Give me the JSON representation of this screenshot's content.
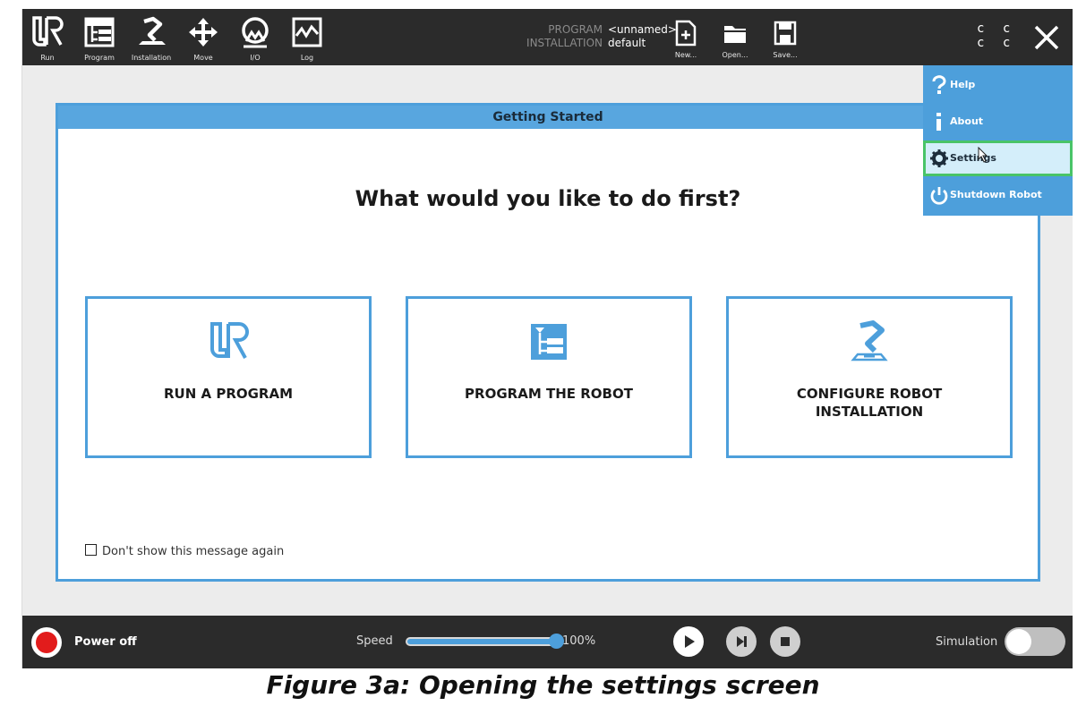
{
  "toolbar": {
    "tabs": [
      {
        "label": "Run",
        "icon": "ur-logo-icon"
      },
      {
        "label": "Program",
        "icon": "program-tree-icon"
      },
      {
        "label": "Installation",
        "icon": "robot-arm-icon"
      },
      {
        "label": "Move",
        "icon": "move-arrows-icon"
      },
      {
        "label": "I/O",
        "icon": "io-icon"
      },
      {
        "label": "Log",
        "icon": "log-chart-icon"
      }
    ],
    "program_key": "PROGRAM",
    "program_value": "<unnamed>",
    "installation_key": "INSTALLATION",
    "installation_value": "default",
    "new_label": "New...",
    "open_label": "Open...",
    "save_label": "Save...",
    "cc_top": "c c",
    "cc_bottom": "c c"
  },
  "dialog": {
    "title": "Getting Started",
    "question": "What would you like to do first?",
    "cards": [
      {
        "line1": "RUN A PROGRAM",
        "line2": ""
      },
      {
        "line1": "PROGRAM THE ROBOT",
        "line2": ""
      },
      {
        "line1": "CONFIGURE ROBOT",
        "line2": "INSTALLATION"
      }
    ],
    "checkbox_label": "Don't show this message again",
    "checkbox_checked": false
  },
  "menu": {
    "items": [
      {
        "label": "Help",
        "icon": "help-icon"
      },
      {
        "label": "About",
        "icon": "info-icon"
      },
      {
        "label": "Settings",
        "icon": "gear-icon",
        "selected": true
      },
      {
        "label": "Shutdown Robot",
        "icon": "power-icon"
      }
    ]
  },
  "bottom": {
    "power_label": "Power off",
    "speed_label": "Speed",
    "speed_value": "100%",
    "speed_fraction": 1.0,
    "simulation_label": "Simulation",
    "simulation_on": false
  },
  "caption": "Figure 3a: Opening the settings screen",
  "colors": {
    "bar": "#2b2b2b",
    "accent": "#4d9fdb",
    "selected_border": "#49c468",
    "power_red": "#e21c1c"
  }
}
